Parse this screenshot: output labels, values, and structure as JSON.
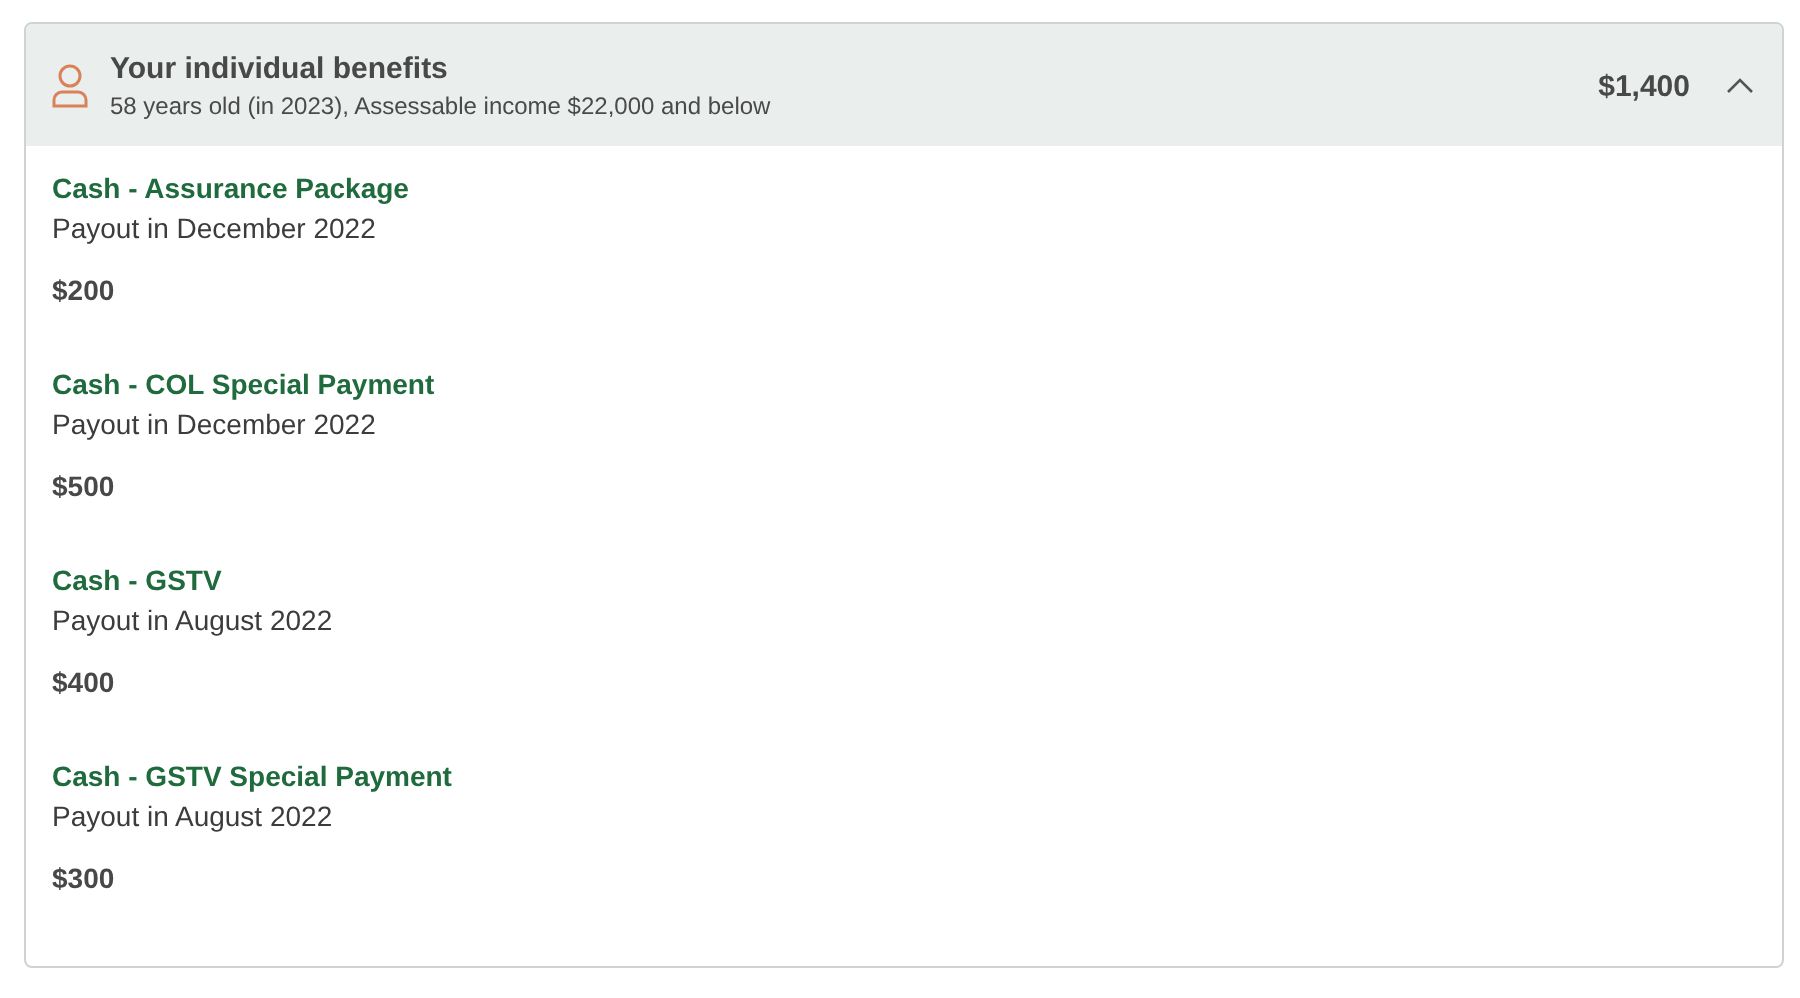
{
  "panel": {
    "title": "Your individual benefits",
    "subtitle": "58 years old (in 2023), Assessable income $22,000 and below",
    "total": "$1,400",
    "expanded": true,
    "items": [
      {
        "name": "Cash - Assurance Package",
        "payout": "Payout in December 2022",
        "amount": "$200"
      },
      {
        "name": "Cash - COL Special Payment",
        "payout": "Payout in December 2022",
        "amount": "$500"
      },
      {
        "name": "Cash - GSTV",
        "payout": "Payout in August 2022",
        "amount": "$400"
      },
      {
        "name": "Cash - GSTV Special Payment",
        "payout": "Payout in August 2022",
        "amount": "$300"
      }
    ]
  }
}
